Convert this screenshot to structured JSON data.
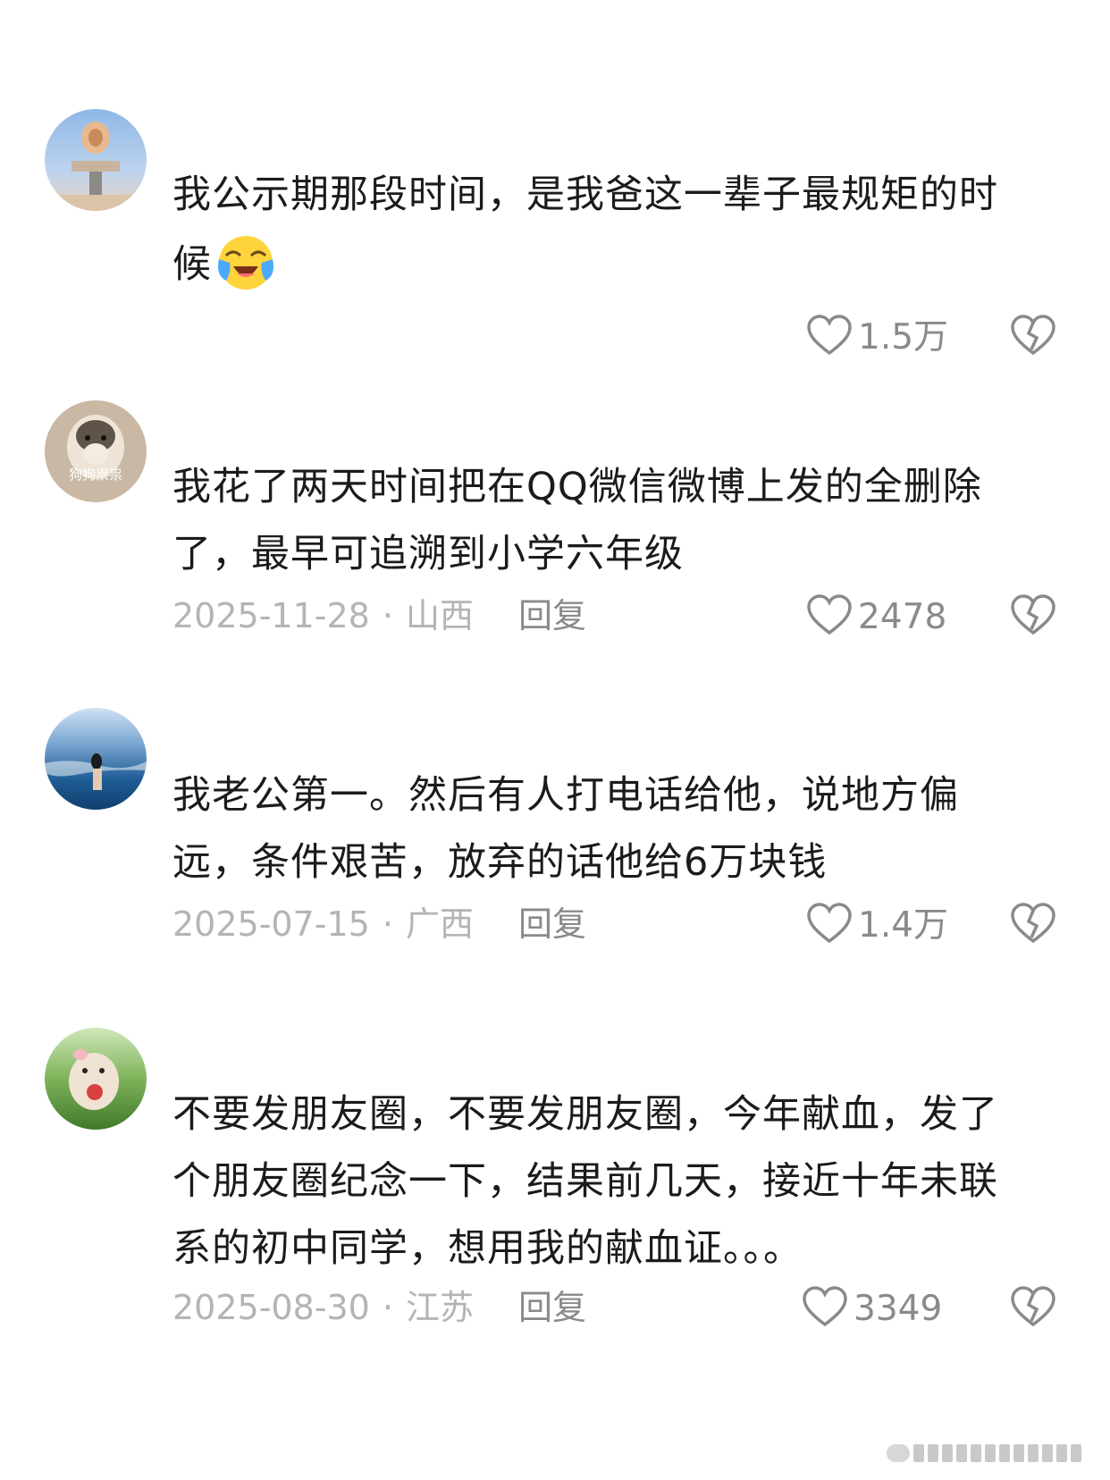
{
  "comments": [
    {
      "text_line1": "我公示期那段时间，是我爸这一辈子最规矩的时",
      "text_line2": "候",
      "emoji_icon": "crying-laughing-emoji-icon",
      "date": "",
      "region": "",
      "reply_label": "",
      "likes": "1.5万"
    },
    {
      "text_line1": "我花了两天时间把在QQ微信微博上发的全删除",
      "text_line2": "了，最早可追溯到小学六年级",
      "date": "2025-11-28",
      "separator": "·",
      "region": "山西",
      "reply_label": "回复",
      "likes": "2478"
    },
    {
      "text_line1": "我老公第一。然后有人打电话给他，说地方偏",
      "text_line2": "远，条件艰苦，放弃的话他给6万块钱",
      "date": "2025-07-15",
      "separator": "·",
      "region": "广西",
      "reply_label": "回复",
      "likes": "1.4万"
    },
    {
      "text_line1": "不要发朋友圈，不要发朋友圈，今年献血，发了",
      "text_line2": "个朋友圈纪念一下，结果前几天，接近十年未联",
      "text_line3": "系的初中同学，想用我的献血证。。。",
      "date": "2025-08-30",
      "separator": "·",
      "region": "江苏",
      "reply_label": "回复",
      "likes": "3349"
    }
  ],
  "avatar_labels": {
    "avatar2_caption": "狗狗祟祟"
  },
  "colors": {
    "text": "#1b1b1b",
    "meta": "#b4b4b4",
    "icon": "#8a8a8a",
    "background": "#ffffff"
  }
}
